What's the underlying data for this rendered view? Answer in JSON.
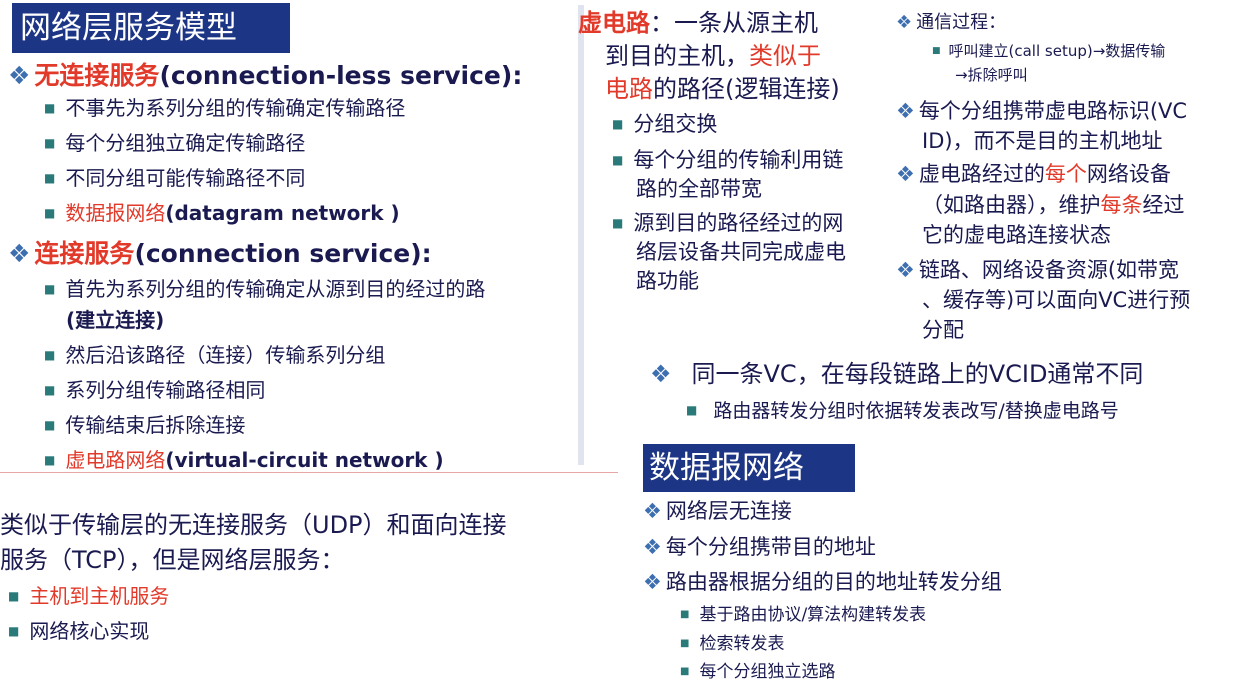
{
  "left": {
    "title": "网络层服务模型",
    "cl_head": "无连接服务",
    "cl_head_en": "(connection-less service):",
    "cl_items": [
      "不事先为系列分组的传输确定传输路径",
      "每个分组独立确定传输路径",
      "不同分组可能传输路径不同"
    ],
    "cl_red": "数据报网络",
    "cl_red_en": "(datagram network )",
    "co_head": "连接服务",
    "co_head_en": "(connection service):",
    "co_item1a": "首先为系列分组的传输确定从源到目的经过的路",
    "co_item1b": "(建立连接)",
    "co_items": [
      "然后沿该路径（连接）传输系列分组",
      "系列分组传输路径相同",
      "传输结束后拆除连接"
    ],
    "co_red": "虚电路网络",
    "co_red_en": "(virtual-circuit network )",
    "analogy1": "类似于传输层的无连接服务（UDP）和面向连接",
    "analogy2": "服务（TCP），但是网络层服务：",
    "b1": "主机到主机服务",
    "b2": "网络核心实现"
  },
  "vc": {
    "head_red": "虚电路",
    "head_rest": "：一条从源主机",
    "line2a": "到目的主机，",
    "line2b": "类似于",
    "line3a": "电路",
    "line3b": "的路径(逻辑连接)",
    "bullets": [
      [
        "分组交换"
      ],
      [
        "每个分组的传输利用链",
        "路的全部带宽"
      ],
      [
        "源到目的路径经过的网",
        "络层设备共同完成虚电",
        "路功能"
      ]
    ],
    "comm": "通信过程：",
    "comm_sub1": "呼叫建立(call setup)→数据传输",
    "comm_sub2": "→拆除呼叫",
    "vcid1": "每个分组携带虚电路标识(VC",
    "vcid2": "ID)，而不是目的主机地址",
    "dev1a": "虚电路经过的",
    "dev1b": "每个",
    "dev1c": "网络设备",
    "dev2a": "（如路由器），维护",
    "dev2b": "每条",
    "dev2c": "经过",
    "dev3": "它的虚电路连接状态",
    "res1": "链路、网络设备资源(如带宽",
    "res2": "、缓存等)可以面向VC进行预",
    "res3": "分配",
    "same": "同一条VC，在每段链路上的VCID通常不同",
    "same_sub": "路由器转发分组时依据转发表改写/替换虚电路号"
  },
  "dg": {
    "title": "数据报网络",
    "items": [
      "网络层无连接",
      "每个分组携带目的地址",
      "路由器根据分组的目的地址转发分组"
    ],
    "subs": [
      "基于路由协议/算法构建转发表",
      "检索转发表",
      "每个分组独立选路"
    ]
  }
}
